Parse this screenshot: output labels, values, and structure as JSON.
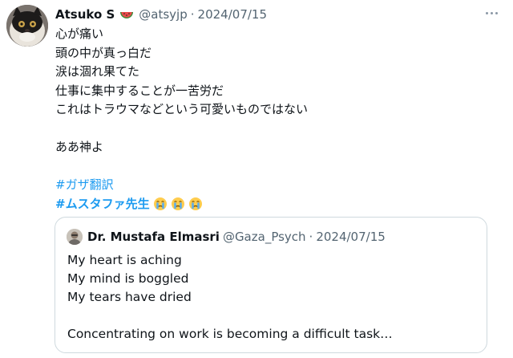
{
  "tweet": {
    "author_name": "Atsuko S",
    "author_emoji": "watermelon-emoji",
    "handle": "@atsyjp",
    "separator": "·",
    "date": "2024/07/15",
    "lines": [
      "心が痛い",
      "頭の中が真っ白だ",
      "涙は涸れ果てた",
      "仕事に集中することが一苦労だ",
      "これはトラウマなどという可愛いものではない",
      "",
      "ああ神よ",
      ""
    ],
    "hashtag_1": "#ガザ翻訳",
    "hashtag_2": "#ムスタファ先生",
    "hashtag_2_emojis": [
      "crying-face-emoji",
      "crying-face-emoji",
      "crying-face-emoji"
    ]
  },
  "quote": {
    "author_name": "Dr. Mustafa Elmasri",
    "handle": "@Gaza_Psych",
    "separator": "·",
    "date": "2024/07/15",
    "lines": [
      "My heart is aching",
      "My mind is boggled",
      "My tears have dried",
      "",
      "Concentrating on work is becoming a difficult task…"
    ]
  },
  "colors": {
    "text": "#0f1419",
    "secondary": "#536471",
    "link": "#1d9bf0",
    "border": "#cfd9de"
  }
}
